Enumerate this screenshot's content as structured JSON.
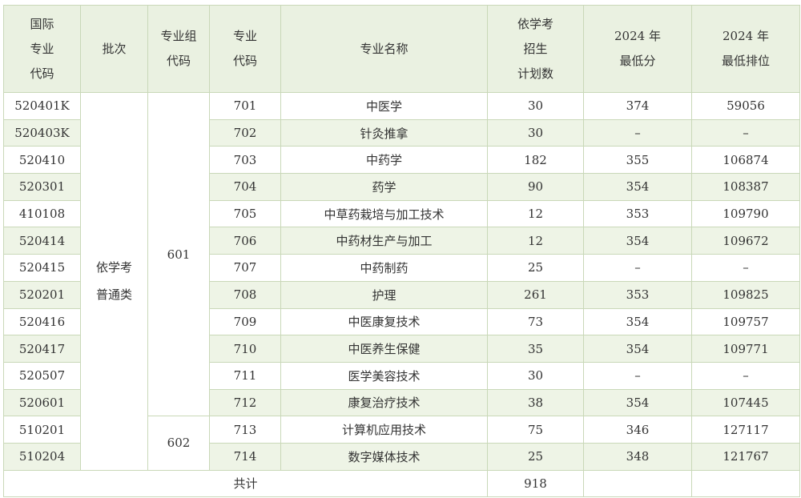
{
  "headers": {
    "intl_code": [
      "国际",
      "专业",
      "代码"
    ],
    "batch": [
      "批次"
    ],
    "group_code": [
      "专业组",
      "代码"
    ],
    "major_code": [
      "专业",
      "代码"
    ],
    "major_name": [
      "专业名称"
    ],
    "plan": [
      "依学考",
      "招生",
      "计划数"
    ],
    "min_score": [
      "2024 年",
      "最低分"
    ],
    "min_rank": [
      "2024 年",
      "最低排位"
    ]
  },
  "batch": [
    "依学考",
    "普通类"
  ],
  "groups": [
    {
      "code": "601",
      "rows": 12
    },
    {
      "code": "602",
      "rows": 2
    }
  ],
  "rows": [
    {
      "intl": "520401K",
      "code": "701",
      "name": "中医学",
      "plan": "30",
      "score": "374",
      "rank": "59056"
    },
    {
      "intl": "520403K",
      "code": "702",
      "name": "针灸推拿",
      "plan": "30",
      "score": "–",
      "rank": "–"
    },
    {
      "intl": "520410",
      "code": "703",
      "name": "中药学",
      "plan": "182",
      "score": "355",
      "rank": "106874"
    },
    {
      "intl": "520301",
      "code": "704",
      "name": "药学",
      "plan": "90",
      "score": "354",
      "rank": "108387"
    },
    {
      "intl": "410108",
      "code": "705",
      "name": "中草药栽培与加工技术",
      "plan": "12",
      "score": "353",
      "rank": "109790"
    },
    {
      "intl": "520414",
      "code": "706",
      "name": "中药材生产与加工",
      "plan": "12",
      "score": "354",
      "rank": "109672"
    },
    {
      "intl": "520415",
      "code": "707",
      "name": "中药制药",
      "plan": "25",
      "score": "–",
      "rank": "–"
    },
    {
      "intl": "520201",
      "code": "708",
      "name": "护理",
      "plan": "261",
      "score": "353",
      "rank": "109825"
    },
    {
      "intl": "520416",
      "code": "709",
      "name": "中医康复技术",
      "plan": "73",
      "score": "354",
      "rank": "109757"
    },
    {
      "intl": "520417",
      "code": "710",
      "name": "中医养生保健",
      "plan": "35",
      "score": "354",
      "rank": "109771"
    },
    {
      "intl": "520507",
      "code": "711",
      "name": "医学美容技术",
      "plan": "30",
      "score": "–",
      "rank": "–"
    },
    {
      "intl": "520601",
      "code": "712",
      "name": "康复治疗技术",
      "plan": "38",
      "score": "354",
      "rank": "107445"
    },
    {
      "intl": "510201",
      "code": "713",
      "name": "计算机应用技术",
      "plan": "75",
      "score": "346",
      "rank": "127117"
    },
    {
      "intl": "510204",
      "code": "714",
      "name": "数字媒体技术",
      "plan": "25",
      "score": "348",
      "rank": "121767"
    }
  ],
  "total": {
    "label": "共计",
    "plan": "918"
  }
}
